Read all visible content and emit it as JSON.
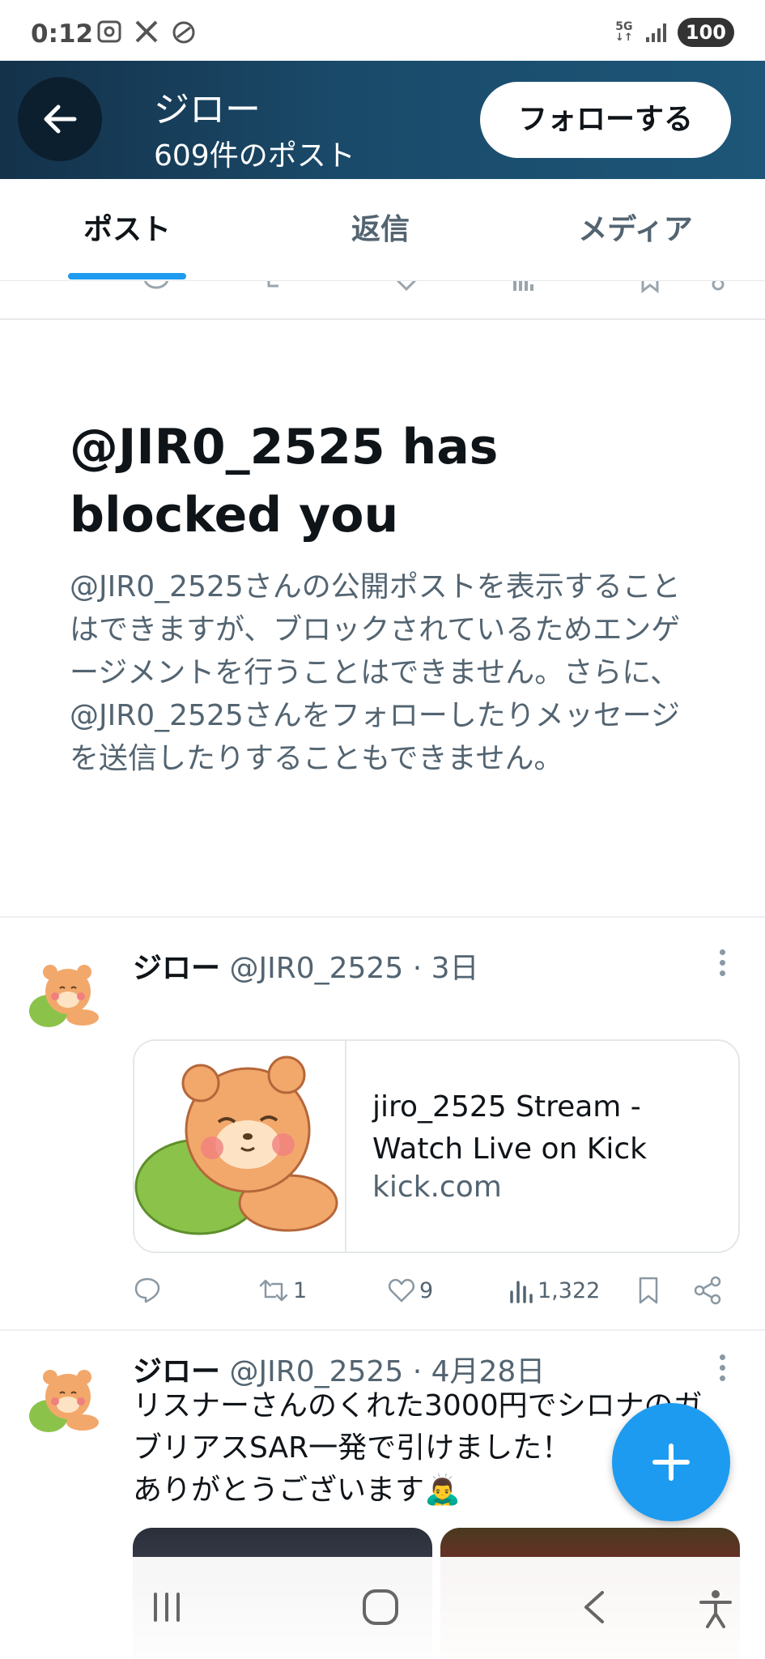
{
  "status_bar": {
    "time": "0:12",
    "network": "5G",
    "battery": "100"
  },
  "header": {
    "name": "ジロー",
    "post_count": "609件のポスト",
    "follow_label": "フォローする"
  },
  "tabs": [
    {
      "label": "ポスト",
      "active": true
    },
    {
      "label": "返信",
      "active": false
    },
    {
      "label": "メディア",
      "active": false
    }
  ],
  "blocked_notice": {
    "title": "@JIR0_2525 has blocked you",
    "body": "@JIR0_2525さんの公開ポストを表示することはできますが、ブロックされているためエンゲージメントを行うことはできません。さらに、@JIR0_2525さんをフォローしたりメッセージを送信したりすることもできません。"
  },
  "tweets": [
    {
      "name": "ジロー",
      "handle": "@JIR0_2525",
      "time": "· 3日",
      "card": {
        "title": "jiro_2525 Stream - Watch Live on Kick",
        "domain": "kick.com"
      },
      "actions": {
        "replies": "",
        "retweets": "1",
        "likes": "9",
        "views": "1,322"
      }
    },
    {
      "name": "ジロー",
      "handle": "@JIR0_2525",
      "time": "· 4月28日",
      "text_line1": "リスナーさんのくれた3000円でシロナのガ",
      "text_line2": "ブリアスSAR一発で引けました！",
      "text_line3": "ありがとうございます🙇‍♂️"
    }
  ],
  "colors": {
    "accent": "#1d9bf0",
    "header_bg": "#1a4a6a",
    "secondary_text": "#536471"
  }
}
